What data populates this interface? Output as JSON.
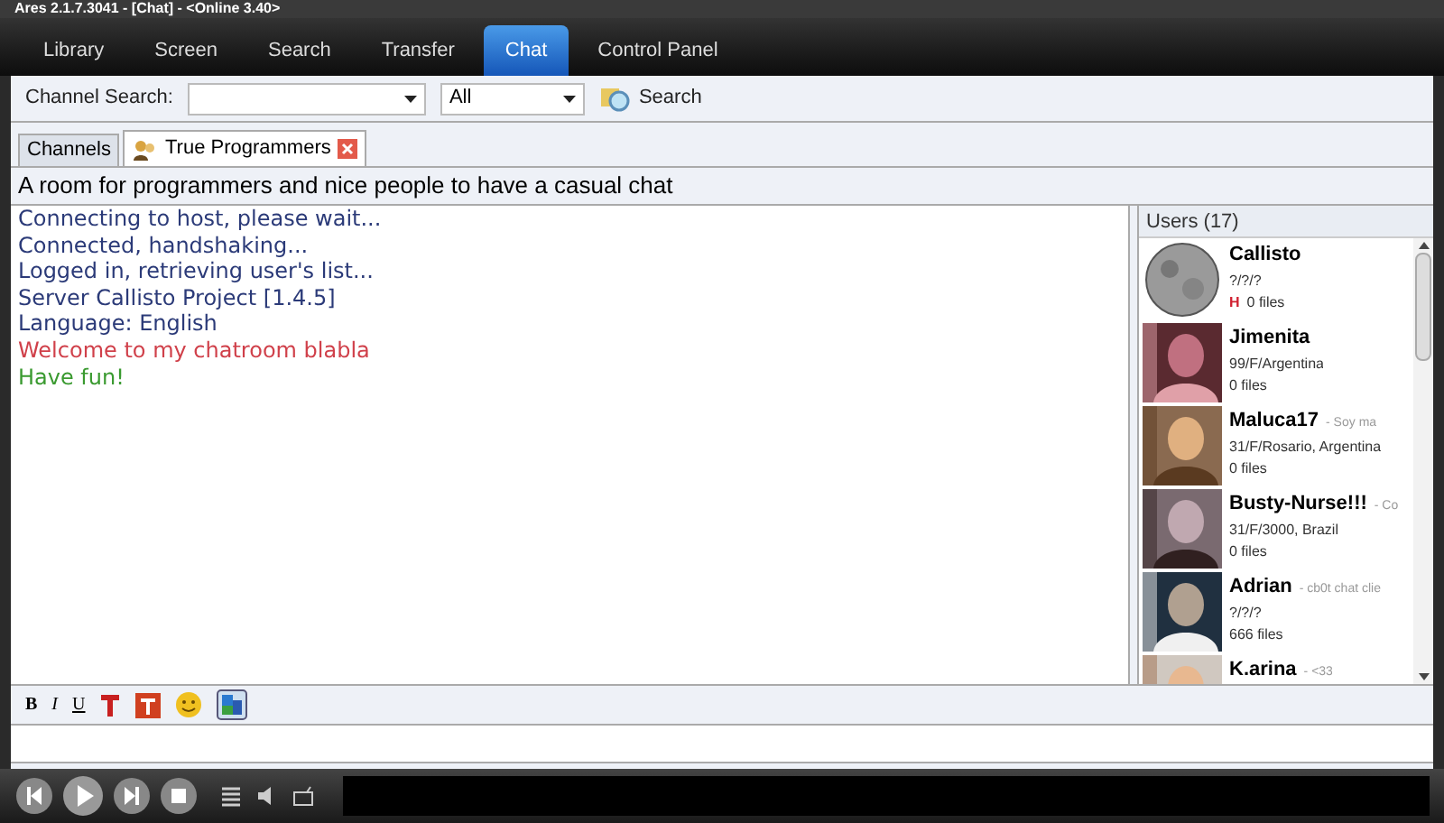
{
  "window": {
    "title": "Ares 2.1.7.3041 - [Chat] - <Online 3.40>"
  },
  "nav_tabs": [
    {
      "label": "Library",
      "selected": false
    },
    {
      "label": "Screen",
      "selected": false
    },
    {
      "label": "Search",
      "selected": false
    },
    {
      "label": "Transfer",
      "selected": false
    },
    {
      "label": "Chat",
      "selected": true
    },
    {
      "label": "Control Panel",
      "selected": false
    }
  ],
  "channel_search": {
    "label": "Channel Search:",
    "filter": "All",
    "button": "Search"
  },
  "room_tabs": [
    {
      "label": "Channels",
      "selected": false,
      "closable": false
    },
    {
      "label": "True Programmers",
      "selected": true,
      "closable": true
    }
  ],
  "topic": "A room for programmers and nice people to have a casual chat",
  "messages": [
    {
      "text": "Connecting to host, please wait...",
      "kind": "system"
    },
    {
      "text": "Connected, handshaking...",
      "kind": "system"
    },
    {
      "text": "Logged in, retrieving user's list...",
      "kind": "system"
    },
    {
      "text": "Server Callisto Project [1.4.5]",
      "kind": "system"
    },
    {
      "text": "Language: English",
      "kind": "system"
    },
    {
      "text": "Welcome to my chatroom blabla",
      "kind": "welcome"
    },
    {
      "text": "Have fun!",
      "kind": "fun"
    }
  ],
  "users": {
    "header": "Users (17)",
    "items": [
      {
        "name": "Callisto",
        "info": "?/?/?",
        "flag": "H",
        "files": "0 files"
      },
      {
        "name": "Jimenita",
        "info": "99/F/Argentina",
        "files": "0 files"
      },
      {
        "name": "Maluca17",
        "status": "- Soy ma",
        "info": "31/F/Rosario, Argentina",
        "files": "0 files"
      },
      {
        "name": "Busty-Nurse!!!",
        "status": "- Co",
        "info": "31/F/3000, Brazil",
        "files": "0 files"
      },
      {
        "name": "Adrian",
        "status": "- cb0t chat clie",
        "info": "?/?/?",
        "files": "666 files"
      },
      {
        "name": "K.arina",
        "status": "- <33"
      }
    ]
  },
  "format_tools": [
    "B",
    "I",
    "U"
  ]
}
